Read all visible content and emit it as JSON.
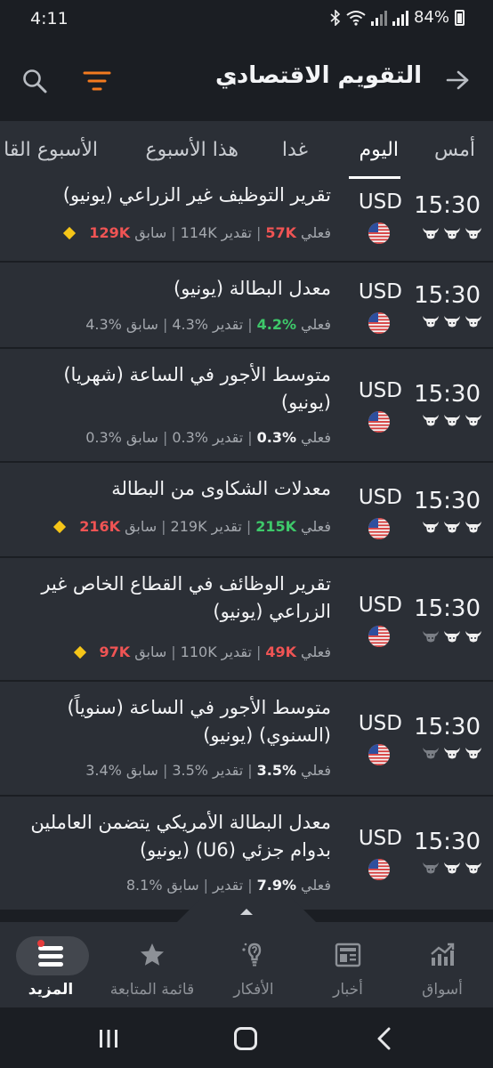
{
  "status": {
    "time": "4:11",
    "battery": "84%"
  },
  "header": {
    "title": "التقويم الاقتصادي"
  },
  "tabs": [
    {
      "label": "أمس",
      "active": false
    },
    {
      "label": "اليوم",
      "active": true
    },
    {
      "label": "غدا",
      "active": false
    },
    {
      "label": "هذا الأسبوع",
      "active": false
    },
    {
      "label": "الأسبوع القا",
      "active": false
    }
  ],
  "labels": {
    "actual": "فعلي",
    "forecast": "تقدير",
    "previous": "سابق"
  },
  "events": [
    {
      "time": "15:30",
      "currency": "USD",
      "title": "تقرير التوظيف غير الزراعي (يونيو)",
      "actual": "57K",
      "actual_color": "red",
      "forecast": "114K",
      "previous": "129K",
      "previous_color": "red",
      "revised": true,
      "importance": 3
    },
    {
      "time": "15:30",
      "currency": "USD",
      "title": "معدل البطالة (يونيو)",
      "actual": "4.2%",
      "actual_color": "green",
      "forecast": "4.3%",
      "previous": "4.3%",
      "previous_color": "gray",
      "revised": false,
      "importance": 3
    },
    {
      "time": "15:30",
      "currency": "USD",
      "title": "متوسط الأجور في الساعة (شهريا) (يونيو)",
      "actual": "0.3%",
      "actual_color": "white",
      "forecast": "0.3%",
      "previous": "0.3%",
      "previous_color": "gray",
      "revised": false,
      "importance": 3
    },
    {
      "time": "15:30",
      "currency": "USD",
      "title": "معدلات الشكاوى من البطالة",
      "actual": "215K",
      "actual_color": "green",
      "forecast": "219K",
      "previous": "216K",
      "previous_color": "red",
      "revised": true,
      "importance": 3
    },
    {
      "time": "15:30",
      "currency": "USD",
      "title": "تقرير الوظائف في القطاع الخاص غير الزراعي (يونيو)",
      "actual": "49K",
      "actual_color": "red",
      "forecast": "110K",
      "previous": "97K",
      "previous_color": "red",
      "revised": true,
      "importance": 2
    },
    {
      "time": "15:30",
      "currency": "USD",
      "title": "متوسط الأجور في الساعة (سنوياً) (السنوي) (يونيو)",
      "actual": "3.5%",
      "actual_color": "white",
      "forecast": "3.5%",
      "previous": "3.4%",
      "previous_color": "gray",
      "revised": false,
      "importance": 2
    },
    {
      "time": "15:30",
      "currency": "USD",
      "title": "معدل البطالة الأمريكي يتضمن العاملين بدوام جزئي (U6) (يونيو)",
      "actual": "7.9%",
      "actual_color": "white",
      "forecast": "",
      "previous": "8.1%",
      "previous_color": "gray",
      "revised": false,
      "importance": 2
    }
  ],
  "bottom_nav": [
    {
      "label": "المزيد",
      "icon": "menu-icon",
      "active": true
    },
    {
      "label": "قائمة المتابعة",
      "icon": "star-icon",
      "active": false
    },
    {
      "label": "الأفكار",
      "icon": "lightbulb-icon",
      "active": false
    },
    {
      "label": "أخبار",
      "icon": "newspaper-icon",
      "active": false
    },
    {
      "label": "أسواق",
      "icon": "chart-icon",
      "active": false
    }
  ],
  "colors": {
    "background": "#1b1e23",
    "panel": "#2b2f36",
    "accent": "#f37a1f",
    "positive": "#3ec96a",
    "negative": "#f05454",
    "revised": "#f5c518"
  }
}
